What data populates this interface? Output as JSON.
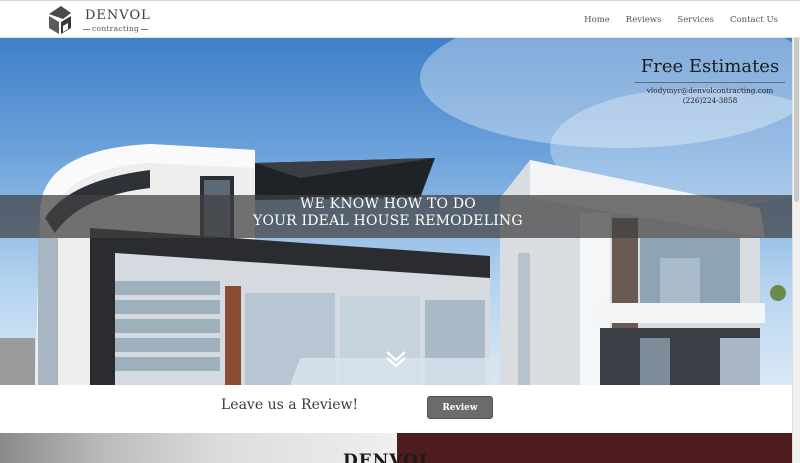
{
  "header": {
    "logo_name": "DENVOL",
    "logo_sub": "contracting",
    "nav": [
      "Home",
      "Reviews",
      "Services",
      "Contact Us"
    ]
  },
  "hero": {
    "estimates_title": "Free Estimates",
    "email": "vlodymyr@denvolcontracting.com",
    "phone": "(226)224-3858",
    "tagline_line1": "WE KNOW HOW TO DO",
    "tagline_line2": "YOUR IDEAL HOUSE REMODELING",
    "scroll_icon": "double-chevron-down-icon"
  },
  "review": {
    "text": "Leave us a Review!",
    "button": "Review"
  },
  "next_section": {
    "title": "DENVOL"
  },
  "colors": {
    "maroon": "#4e1c1c",
    "button_gray": "#6b6b6b",
    "band_overlay": "rgba(64,64,64,0.72)"
  }
}
